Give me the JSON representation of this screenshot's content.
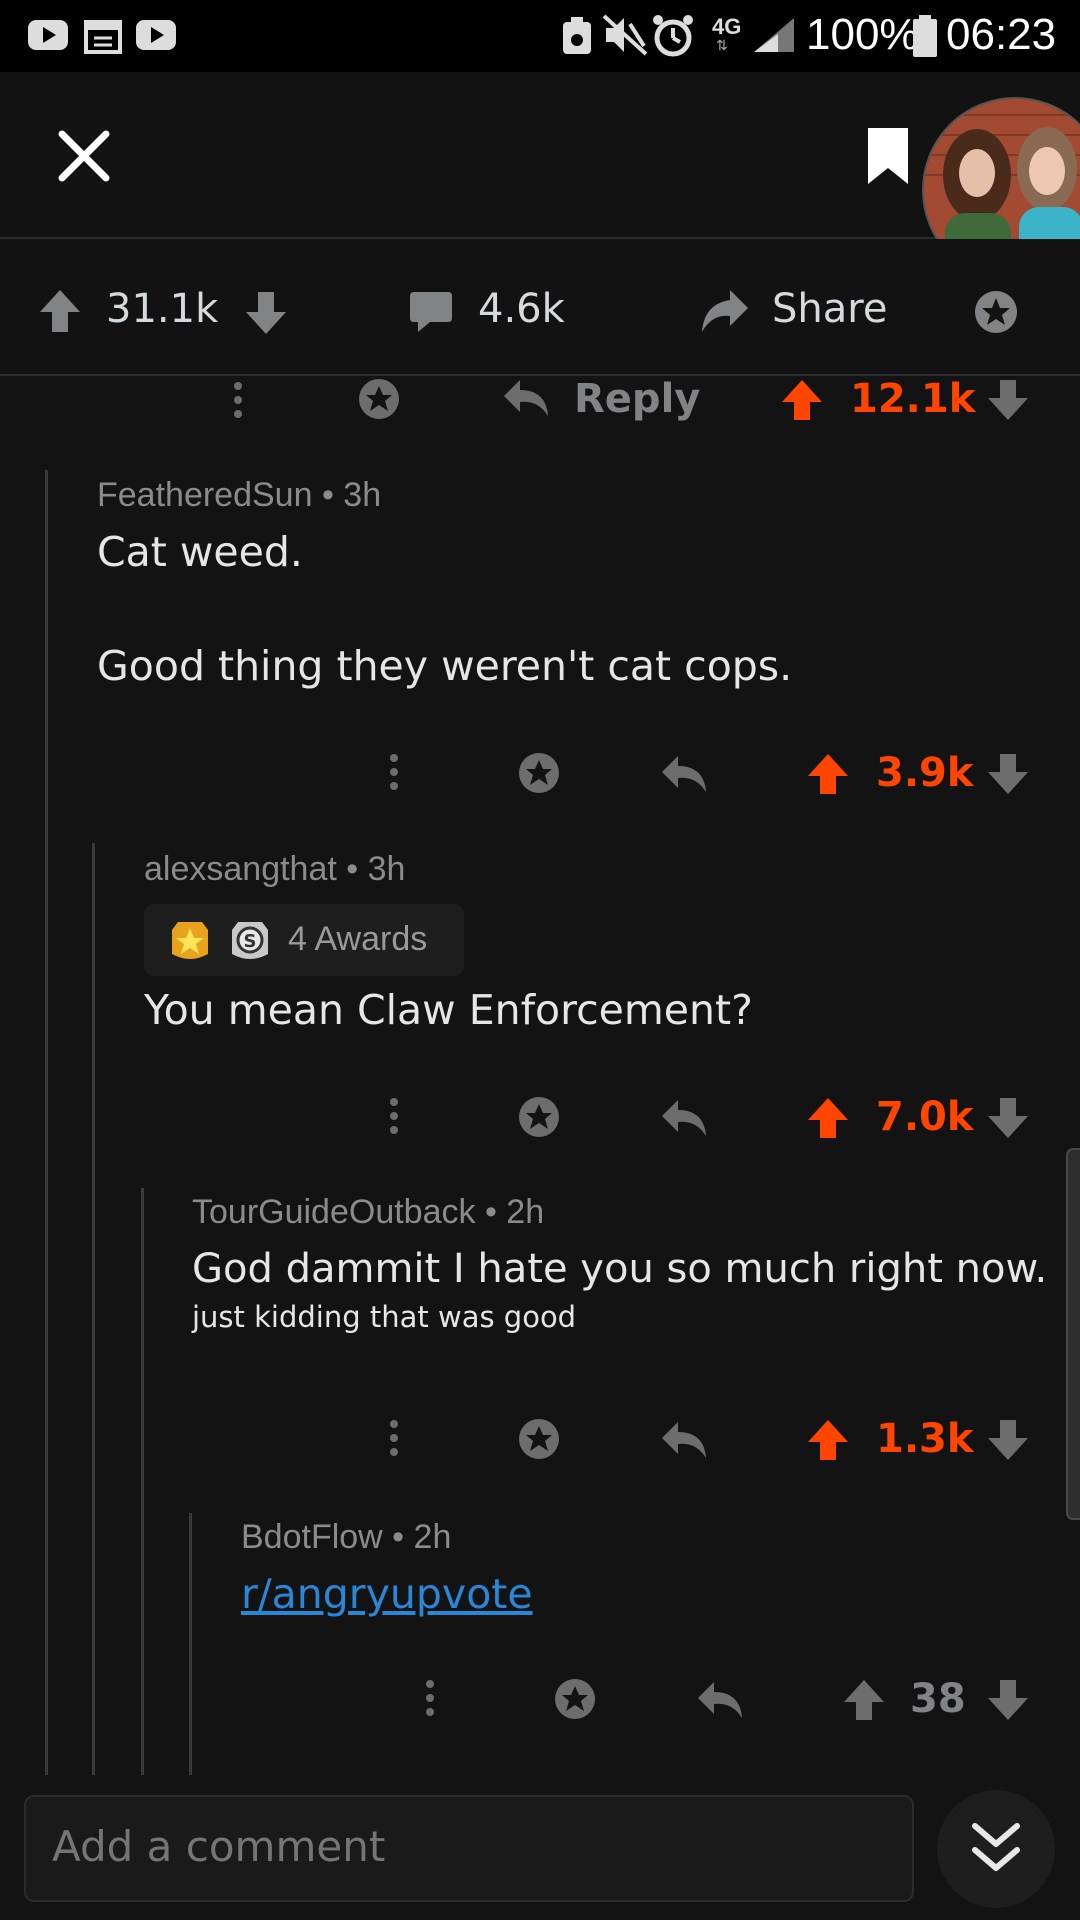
{
  "status_bar": {
    "battery": "100%",
    "time": "06:23",
    "network": "4G"
  },
  "post_actions": {
    "upvotes": "31.1k",
    "comments": "4.6k",
    "share": "Share"
  },
  "parent_comment_actions": {
    "reply": "Reply",
    "score": "12.1k"
  },
  "comments": [
    {
      "author": "FeatheredSun",
      "age": "3h",
      "lines": [
        "Cat weed.",
        "Good thing they weren't cat cops."
      ],
      "score": "3.9k",
      "upvoted": true
    },
    {
      "author": "alexsangthat",
      "age": "3h",
      "awards": "4 Awards",
      "lines": [
        "You mean Claw Enforcement?"
      ],
      "score": "7.0k",
      "upvoted": true
    },
    {
      "author": "TourGuideOutback",
      "age": "2h",
      "lines": [
        "God dammit I hate you so much right now.",
        "just kidding that was good"
      ],
      "score": "1.3k",
      "upvoted": true
    },
    {
      "author": "BdotFlow",
      "age": "2h",
      "link": "r/angryupvote",
      "score": "38",
      "upvoted": false
    }
  ],
  "composer": {
    "placeholder": "Add a comment"
  },
  "colors": {
    "upvote": "#ff4500",
    "link": "#2a86d6",
    "background": "#131313"
  },
  "icons": [
    "close-icon",
    "bookmark-icon",
    "upvote-icon",
    "downvote-icon",
    "comment-icon",
    "share-icon",
    "award-icon",
    "more-icon",
    "reply-icon",
    "chevron-double-down-icon"
  ]
}
